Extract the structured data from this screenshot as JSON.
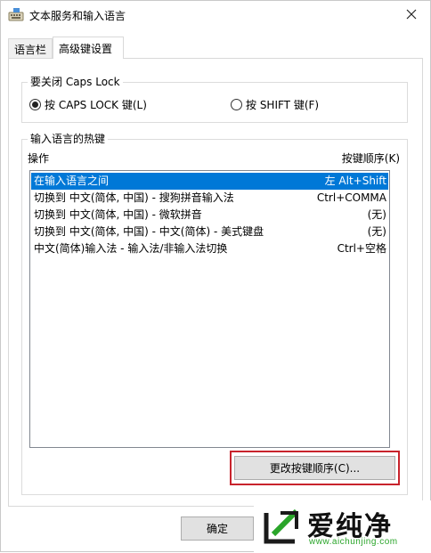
{
  "window": {
    "title": "文本服务和输入语言"
  },
  "tabs": [
    {
      "label": "语言栏",
      "active": false
    },
    {
      "label": "高级键设置",
      "active": true
    }
  ],
  "caps_group": {
    "title": "要关闭 Caps Lock",
    "option_caps": "按 CAPS LOCK 键(L)",
    "option_shift": "按 SHIFT 键(F)",
    "selected": "caps"
  },
  "hotkey_group": {
    "title": "输入语言的热键",
    "col_action": "操作",
    "col_keys": "按键顺序(K)",
    "rows": [
      {
        "action": "在输入语言之间",
        "keys": "左 Alt+Shift",
        "selected": true
      },
      {
        "action": "切换到 中文(简体, 中国) - 搜狗拼音输入法",
        "keys": "Ctrl+COMMA",
        "selected": false
      },
      {
        "action": "切换到 中文(简体, 中国) - 微软拼音",
        "keys": "(无)",
        "selected": false
      },
      {
        "action": "切换到 中文(简体, 中国) - 中文(简体) - 美式键盘",
        "keys": "(无)",
        "selected": false
      },
      {
        "action": "中文(简体)输入法 - 输入法/非输入法切换",
        "keys": "Ctrl+空格",
        "selected": false
      }
    ],
    "change_button": "更改按键顺序(C)..."
  },
  "footer": {
    "ok_button": "确定"
  },
  "watermark": {
    "name": "爱纯净",
    "url": "www.aichunjing.com"
  },
  "colors": {
    "selection": "#0078d7",
    "highlight": "#c8232c",
    "watermark_green": "#2aa52a"
  }
}
